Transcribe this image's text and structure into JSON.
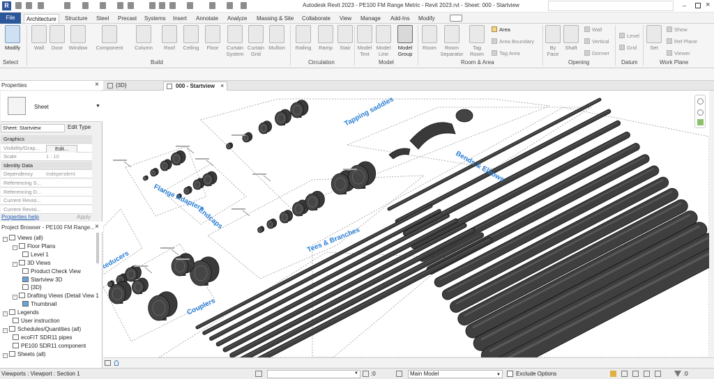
{
  "window": {
    "title": "Autodesk Revit 2023 - PE100 FM Range Metric - Revit 2023.rvt - Sheet: 000 - Startview"
  },
  "ribbon_tabs": [
    "File",
    "Architecture",
    "Structure",
    "Steel",
    "Precast",
    "Systems",
    "Insert",
    "Annotate",
    "Analyze",
    "Massing & Site",
    "Collaborate",
    "View",
    "Manage",
    "Add-Ins",
    "Modify"
  ],
  "selected_tab": "Architecture",
  "ribbon": {
    "select": {
      "modify": "Modify",
      "select_dropdown": "Select"
    },
    "build": [
      "Wall",
      "Door",
      "Window",
      "Component",
      "Column",
      "Roof",
      "Ceiling",
      "Floor",
      "Curtain System",
      "Curtain Grid",
      "Mullion"
    ],
    "circulation": [
      "Railing",
      "Ramp",
      "Stair"
    ],
    "model": [
      "Model Text",
      "Model Line",
      "Model Group"
    ],
    "room_area_big": [
      "Room",
      "Room Separator",
      "Tag Room"
    ],
    "room_area_small": [
      "Area",
      "Area Boundary",
      "Tag Area"
    ],
    "opening": {
      "big": [
        "By Face",
        "Shaft"
      ],
      "small": [
        "Wall",
        "Vertical",
        "Dormer"
      ]
    },
    "datum": [
      "Level",
      "Grid"
    ],
    "work_plane_big": "Set",
    "work_plane_small": [
      "Show",
      "Ref Plane",
      "Viewer"
    ],
    "panels": [
      "Select",
      "Build",
      "Circulation",
      "Model",
      "Room & Area",
      "Opening",
      "Datum",
      "Work Plane"
    ]
  },
  "properties": {
    "title": "Properties",
    "type_label": "Sheet",
    "instance": "Sheet: Startview",
    "edit_type": "Edit Type",
    "rows": [
      {
        "k": "Graphics",
        "v": "",
        "group": true
      },
      {
        "k": "Visibility/Grap...",
        "v": "Edit...",
        "btn": true
      },
      {
        "k": "Scale",
        "v": "1 : 10"
      },
      {
        "k": "Identity Data",
        "v": "",
        "group": true
      },
      {
        "k": "Dependency",
        "v": "Independent"
      },
      {
        "k": "Referencing S...",
        "v": ""
      },
      {
        "k": "Referencing D...",
        "v": ""
      },
      {
        "k": "Current Revisi...",
        "v": ""
      },
      {
        "k": "Current Revisi...",
        "v": ""
      }
    ],
    "help": "Properties help",
    "apply": "Apply"
  },
  "browser": {
    "title": "Project Browser - PE100 FM Range...",
    "items": [
      {
        "label": "Views (all)",
        "level": 0,
        "tg": "-"
      },
      {
        "label": "Floor Plans",
        "level": 1,
        "tg": "-"
      },
      {
        "label": "Level 1",
        "level": 2
      },
      {
        "label": "3D Views",
        "level": 1,
        "tg": "-"
      },
      {
        "label": "Product Check View",
        "level": 2
      },
      {
        "label": "Startview 3D",
        "level": 2
      },
      {
        "label": "{3D}",
        "level": 2
      },
      {
        "label": "Drafting Views (Detail View 1",
        "level": 1,
        "tg": "-"
      },
      {
        "label": "Thumbnail",
        "level": 2
      },
      {
        "label": "Legends",
        "level": 0,
        "tg": "-"
      },
      {
        "label": "User instruction",
        "level": 1
      },
      {
        "label": "Schedules/Quantities (all)",
        "level": 0,
        "tg": "-"
      },
      {
        "label": "ecoFIT SDR11 pipes",
        "level": 1
      },
      {
        "label": "PE100 SDR11 component",
        "level": 1
      },
      {
        "label": "Sheets (all)",
        "level": 0,
        "tg": "-"
      }
    ]
  },
  "view_tabs": [
    {
      "label": "{3D}",
      "active": false
    },
    {
      "label": "000 - Startview",
      "active": true
    }
  ],
  "canvas_labels": [
    "Tapping saddles",
    "Flange Adapters",
    "Endcaps",
    "Bends & Elbows",
    "Tees & Branches",
    "Reducers",
    "Couplers"
  ],
  "status": {
    "left": "Viewports : Viewport : Section 1",
    "zero": ":0",
    "model": "Main Model",
    "exclude": "Exclude Options",
    "filter_count": ":0"
  },
  "colors": {
    "accent": "#2b579a",
    "label_blue": "#2a7fd4",
    "pipe": "#3f3f3f"
  }
}
